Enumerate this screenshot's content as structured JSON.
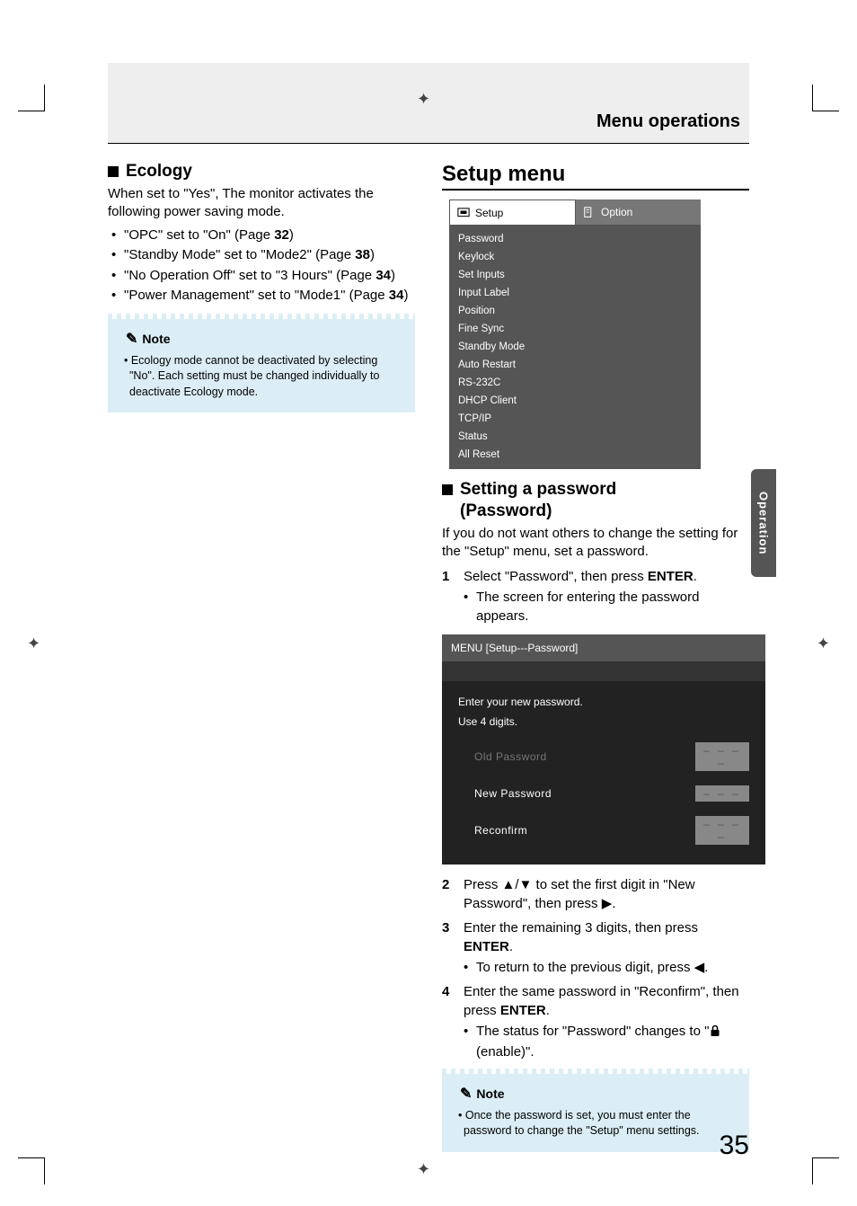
{
  "header": {
    "title": "Menu operations"
  },
  "side_tab": "Operation",
  "page_number": "35",
  "ecology": {
    "heading": "Ecology",
    "intro": "When set to \"Yes\", The monitor activates the following power saving mode.",
    "bullets": [
      {
        "pre": "\"OPC\" set to \"On\" (Page ",
        "page": "32",
        "post": ")"
      },
      {
        "pre": "\"Standby Mode\" set to \"Mode2\" (Page ",
        "page": "38",
        "post": ")"
      },
      {
        "pre": "\"No Operation Off\" set to \"3 Hours\" (Page ",
        "page": "34",
        "post": ")"
      },
      {
        "pre": "\"Power Management\" set to \"Mode1\" (Page ",
        "page": "34",
        "post": ")"
      }
    ],
    "note_label": "Note",
    "note_body": "• Ecology mode cannot be deactivated by selecting \"No\". Each setting must be changed individually to deactivate Ecology mode."
  },
  "setup": {
    "title": "Setup menu",
    "osd": {
      "tab_active": "Setup",
      "tab_inactive": "Option",
      "items": [
        "Password",
        "Keylock",
        "Set Inputs",
        "Input Label",
        "Position",
        "Fine Sync",
        "Standby Mode",
        "Auto Restart",
        "RS-232C",
        "DHCP Client",
        "TCP/IP",
        "Status",
        "All Reset"
      ]
    },
    "password": {
      "heading_line1": "Setting a password",
      "heading_line2": "(Password)",
      "intro": "If you do not want others to change the setting for the \"Setup\" menu, set a password.",
      "step1_pre": "Select \"Password\", then press ",
      "step1_bold": "ENTER",
      "step1_post": ".",
      "step1_sub": "The screen for entering the password appears.",
      "osd_title": "MENU [Setup---Password]",
      "osd_line1": "Enter your new password.",
      "osd_line2": "Use 4 digits.",
      "rows": [
        {
          "label": "Old Password",
          "mask": "– – – –"
        },
        {
          "label": "New Password",
          "mask": "– – –"
        },
        {
          "label": "Reconfirm",
          "mask": "– – – –"
        }
      ],
      "step2": "Press ▲/▼ to set the first digit in \"New Password\", then press ▶.",
      "step3_pre": "Enter the remaining 3 digits, then press ",
      "step3_bold": "ENTER",
      "step3_post": ".",
      "step3_sub": "To return to the previous digit, press ◀.",
      "step4_pre": "Enter the same password in \"Reconfirm\", then press ",
      "step4_bold": "ENTER",
      "step4_post": ".",
      "step4_sub_pre": "The status for \"Password\" changes to \"",
      "step4_sub_post": " (enable)\".",
      "note_label": "Note",
      "note_body": "• Once the password is set, you must enter the password to change the \"Setup\" menu settings."
    }
  }
}
